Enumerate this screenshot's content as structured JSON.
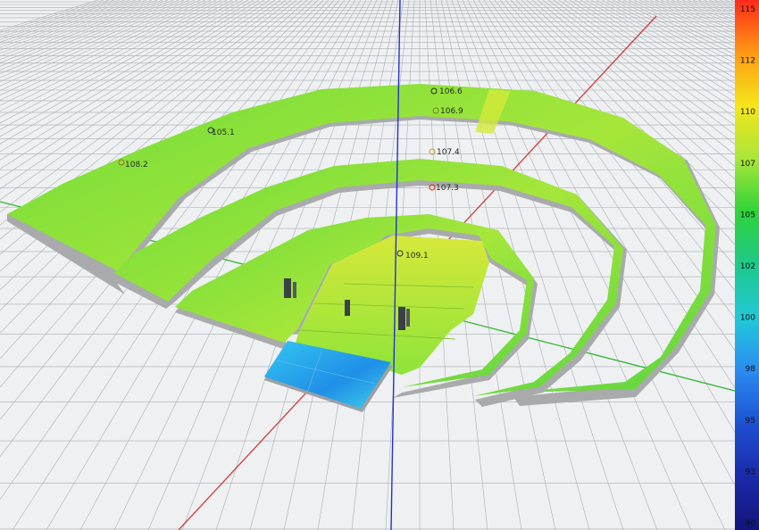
{
  "color_scale": {
    "ticks": [
      "115",
      "112",
      "110",
      "107",
      "105",
      "102",
      "100",
      "98",
      "95",
      "93",
      "90"
    ],
    "colors": [
      "#ff2a1a",
      "#ff9a14",
      "#f5e61a",
      "#a8e63a",
      "#2fd33a",
      "#1ec98a",
      "#22c8d8",
      "#2a8cf0",
      "#1e50d2",
      "#1a2aa8",
      "#14147a"
    ]
  },
  "measurements": [
    {
      "id": "m1",
      "value": "106.6"
    },
    {
      "id": "m2",
      "value": "106.9"
    },
    {
      "id": "m3",
      "value": "105.1"
    },
    {
      "id": "m4",
      "value": "108.2"
    },
    {
      "id": "m5",
      "value": "107.4"
    },
    {
      "id": "m6",
      "value": "107.3"
    },
    {
      "id": "m7",
      "value": "109.1"
    }
  ],
  "axis_colors": {
    "x": "#d23a3a",
    "y": "#2eb82e",
    "z": "#2233cc"
  },
  "surface_colors": {
    "seating": "#78e23c",
    "seating_hot": "#c8e83a",
    "stage_blue": "#2aa6ee",
    "edge": "#a8aaac"
  }
}
